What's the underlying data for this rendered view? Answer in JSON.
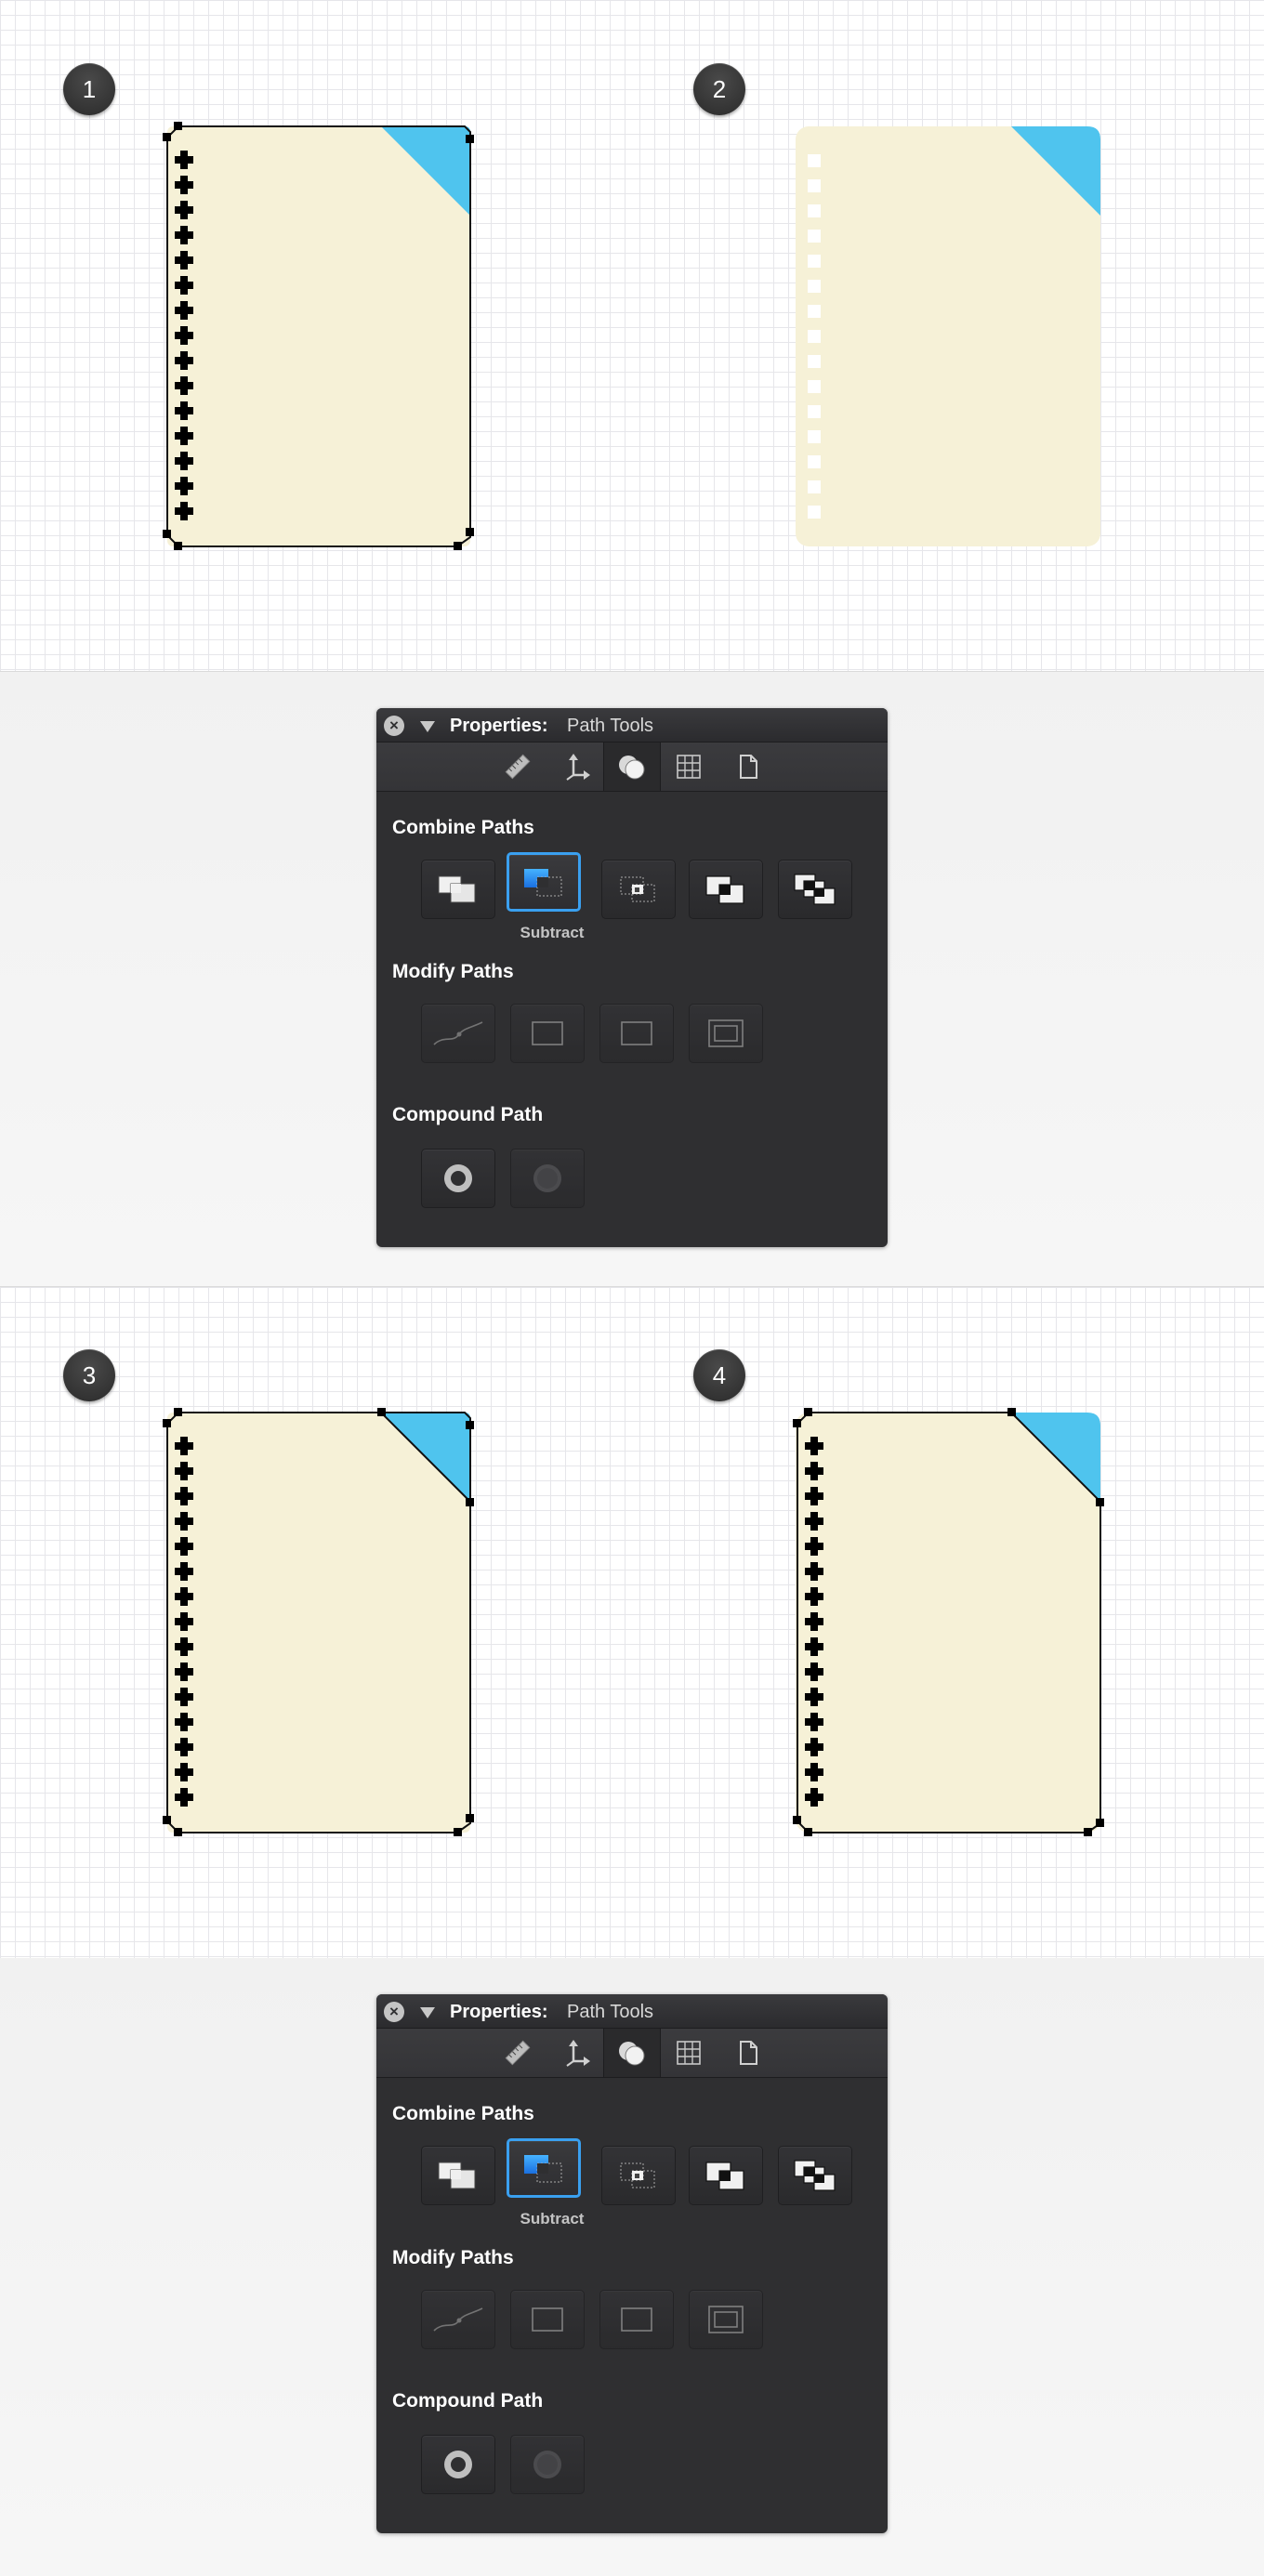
{
  "steps": [
    {
      "number": "1",
      "variant": "outline-selected"
    },
    {
      "number": "2",
      "variant": "result-holes"
    },
    {
      "number": "3",
      "variant": "outline-selected"
    },
    {
      "number": "4",
      "variant": "outline-selected"
    }
  ],
  "colors": {
    "paper": "#f6f1d7",
    "corner": "#4fc4ee",
    "selected_button_border": "#3aa0f0",
    "panel_background": "#2f2f31"
  },
  "panels": [
    {
      "title": "Properties:",
      "subtitle": "Path Tools",
      "close_icon": "×",
      "tabs": [
        "ruler-icon",
        "move-axes-icon",
        "path-shapes-icon",
        "grid-icon",
        "page-icon"
      ],
      "active_tab": "path-shapes-icon",
      "combine_heading": "Combine Paths",
      "combine_buttons": [
        "union",
        "subtract",
        "intersect",
        "exclude",
        "divide"
      ],
      "selected_button": "subtract",
      "selected_caption": "Subtract",
      "modify_heading": "Modify Paths",
      "modify_buttons": [
        "simplify",
        "offset",
        "outline",
        "inset"
      ],
      "compound_heading": "Compound Path",
      "compound_buttons": [
        "make-compound",
        "release-compound"
      ]
    },
    {
      "title": "Properties:",
      "subtitle": "Path Tools",
      "close_icon": "×",
      "tabs": [
        "ruler-icon",
        "move-axes-icon",
        "path-shapes-icon",
        "grid-icon",
        "page-icon"
      ],
      "active_tab": "path-shapes-icon",
      "combine_heading": "Combine Paths",
      "combine_buttons": [
        "union",
        "subtract",
        "intersect",
        "exclude",
        "divide"
      ],
      "selected_button": "subtract",
      "selected_caption": "Subtract",
      "modify_heading": "Modify Paths",
      "modify_buttons": [
        "simplify",
        "offset",
        "outline",
        "inset"
      ],
      "compound_heading": "Compound Path",
      "compound_buttons": [
        "make-compound",
        "release-compound"
      ]
    }
  ]
}
